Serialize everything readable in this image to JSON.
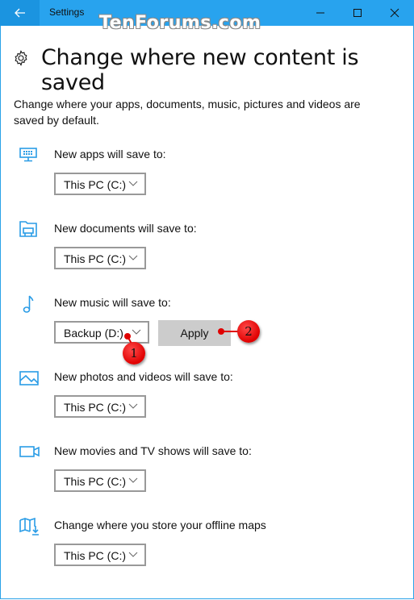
{
  "window": {
    "title": "Settings",
    "watermark": "TenForums.com",
    "back_icon": "back-arrow-icon",
    "controls": [
      "minimize-icon",
      "maximize-icon",
      "close-icon"
    ]
  },
  "header": {
    "icon": "gear-icon",
    "title": "Change where new content is saved"
  },
  "description": "Change where your apps, documents, music, pictures and videos are saved by default.",
  "rows": [
    {
      "icon": "monitor-icon",
      "label": "New apps will save to:",
      "value": "This PC (C:)"
    },
    {
      "icon": "folder-icon",
      "label": "New documents will save to:",
      "value": "This PC (C:)"
    },
    {
      "icon": "music-note-icon",
      "label": "New music will save to:",
      "value": "Backup (D:)",
      "apply_label": "Apply"
    },
    {
      "icon": "image-icon",
      "label": "New photos and videos will save to:",
      "value": "This PC (C:)"
    },
    {
      "icon": "video-camera-icon",
      "label": "New movies and TV shows will save to:",
      "value": "This PC (C:)"
    },
    {
      "icon": "map-download-icon",
      "label": "Change where you store your offline maps",
      "value": "This PC (C:)"
    }
  ],
  "annotations": [
    {
      "number": "1",
      "target": "music dropdown"
    },
    {
      "number": "2",
      "target": "Apply button"
    }
  ],
  "colors": {
    "titlebar": "#28a3ee",
    "back_button": "#1b94e0",
    "icon_accent": "#2a9ce6",
    "callout": "#e00000"
  }
}
